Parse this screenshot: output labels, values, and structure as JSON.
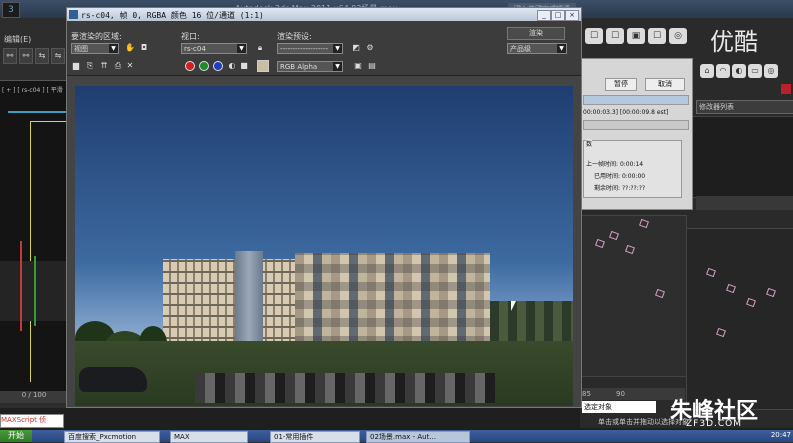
{
  "max": {
    "logo": "3",
    "title": "Autodesk 3ds Max  2011 x64    02场景.max",
    "search_hint": "键入关键字或短语",
    "edit_label": "编辑(E)",
    "viewport_label": "[ + ] [ rs-c04 ] [ 平滑",
    "timeline": "0 / 100",
    "maxscript": "MAXScript 侦",
    "ruler": [
      "85",
      "90"
    ],
    "select_object": "选定对象",
    "click_hint": "单击或单击并拖动以选择对象",
    "object_list": "修改器列表",
    "tool_icons": [
      "⚯",
      "⚯",
      "⇆",
      "⇋"
    ],
    "cmd_icons": [
      "☐",
      "☐",
      "▣",
      "☐",
      "◎"
    ],
    "row2_icons": [
      "⌂",
      "◠",
      "◐",
      "▭",
      "◎"
    ]
  },
  "render_window": {
    "title": "rs-c04, 帧 0, RGBA 颜色 16 位/通道 (1:1)",
    "area_label": "要渲染的区域:",
    "area_value": "视图",
    "viewport_label": "视口:",
    "viewport_value": "rs-c04",
    "preset_label": "渲染预设:",
    "preset_value": "-------------------",
    "render_button": "渲染",
    "quality_value": "产品级",
    "channel_value": "RGB Alpha",
    "colors": {
      "red": "#d0201f",
      "green": "#1f8a2a",
      "blue": "#1f3fc0",
      "swatch": "#c9bfa0"
    }
  },
  "progress": {
    "pause": "暂停",
    "cancel": "取消",
    "time_line": "00:00:03.3] [00:00:09.8 est]",
    "group_title": "数",
    "rows": [
      {
        "label": "上一帧时间:",
        "value": "0:00:14"
      },
      {
        "label": "已用时间:",
        "value": "0:00:00"
      },
      {
        "label": "剩余时间:",
        "value": "??:??:??"
      }
    ]
  },
  "watermark": {
    "top": "优酷",
    "logo": "朱峰社区",
    "url": "ZF3D.COM"
  },
  "taskbar": {
    "start": "开始",
    "items": [
      "百度搜索_Pxcmotion",
      "MAX",
      "01-常用插件",
      "02场景.max - Aut..."
    ],
    "clock": "20:47"
  }
}
